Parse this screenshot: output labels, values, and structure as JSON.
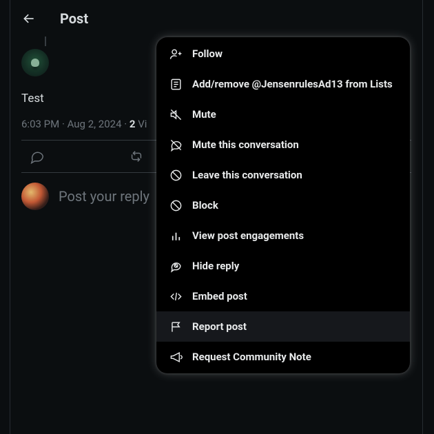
{
  "header": {
    "title": "Post"
  },
  "post": {
    "text": "Test",
    "time": "6:03 PM",
    "date": "Aug 2, 2024",
    "views_number": "2",
    "views_label_truncated": "Vi"
  },
  "reply": {
    "placeholder": "Post your reply"
  },
  "menu": {
    "items": [
      {
        "icon": "user-plus-icon",
        "label": "Follow"
      },
      {
        "icon": "list-icon",
        "label": "Add/remove @JensenrulesAd13 from Lists"
      },
      {
        "icon": "mute-icon",
        "label": "Mute"
      },
      {
        "icon": "mute-convo-icon",
        "label": "Mute this conversation"
      },
      {
        "icon": "leave-convo-icon",
        "label": "Leave this conversation"
      },
      {
        "icon": "block-icon",
        "label": "Block"
      },
      {
        "icon": "analytics-icon",
        "label": "View post engagements"
      },
      {
        "icon": "hide-reply-icon",
        "label": "Hide reply"
      },
      {
        "icon": "embed-icon",
        "label": "Embed post"
      },
      {
        "icon": "flag-icon",
        "label": "Report post",
        "selected": true
      },
      {
        "icon": "megaphone-icon",
        "label": "Request Community Note"
      }
    ]
  }
}
